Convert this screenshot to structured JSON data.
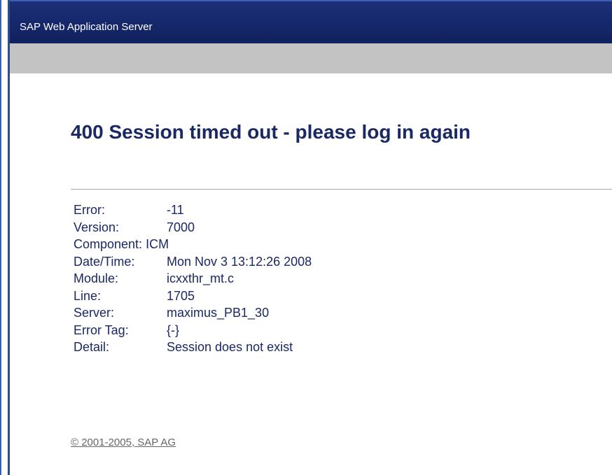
{
  "window": {
    "title": "SAP Web Application Server"
  },
  "page": {
    "heading": "400 Session timed out - please log in again"
  },
  "details": [
    {
      "label": "Error:",
      "value": "-11"
    },
    {
      "label": "Version:",
      "value": "7000"
    },
    {
      "label": "Component:",
      "value": "ICM"
    },
    {
      "label": "Date/Time:",
      "value": "Mon Nov 3 13:12:26 2008"
    },
    {
      "label": "Module:",
      "value": "icxxthr_mt.c"
    },
    {
      "label": "Line:",
      "value": "1705"
    },
    {
      "label": "Server:",
      "value": "maximus_PB1_30"
    },
    {
      "label": "Error Tag:",
      "value": "{-}"
    },
    {
      "label": "Detail:",
      "value": "Session does not exist"
    }
  ],
  "footer": {
    "copyright": "© 2001-2005, SAP AG"
  },
  "colors": {
    "titlebar": "#1c2f78",
    "greybar": "#c3c3c3",
    "text": "#1a2864",
    "link": "#666666"
  }
}
